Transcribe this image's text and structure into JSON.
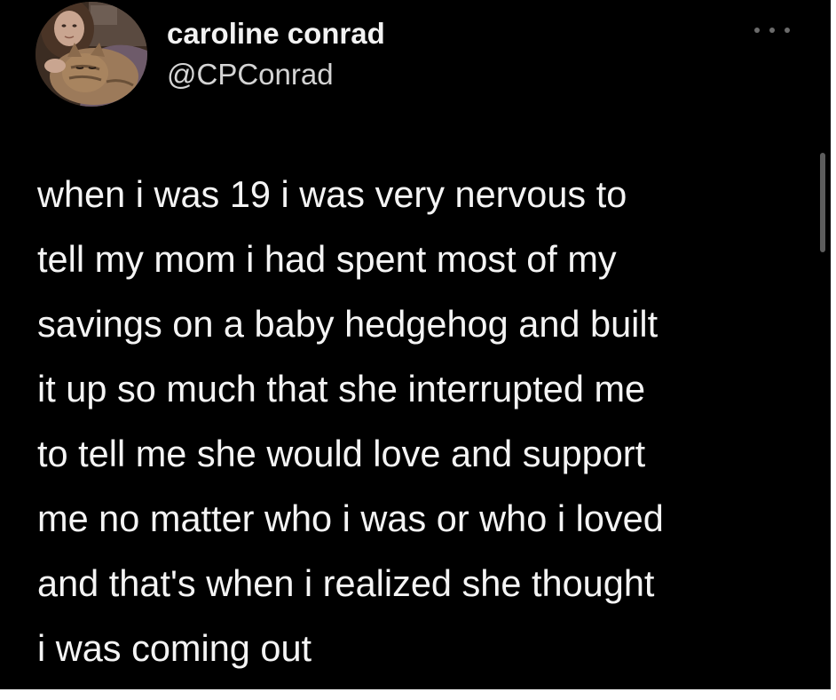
{
  "tweet": {
    "display_name": "caroline conrad",
    "handle": "@CPConrad",
    "lines": [
      "when i was 19 i was very nervous to",
      "tell my mom i had spent most of my",
      "savings on a baby hedgehog and built",
      "it up so much that she interrupted me",
      "to tell me she would love and support",
      "me no matter who i was or who i loved",
      "and that's when i realized she thought",
      "i was coming out"
    ]
  },
  "icons": {
    "more": "more-options-icon",
    "avatar": "profile-photo"
  },
  "colors": {
    "background": "#000000",
    "name": "#f2f2f2",
    "handle": "#d4d4d4",
    "text": "#f4f4f4",
    "dots": "#6b6b6b"
  }
}
